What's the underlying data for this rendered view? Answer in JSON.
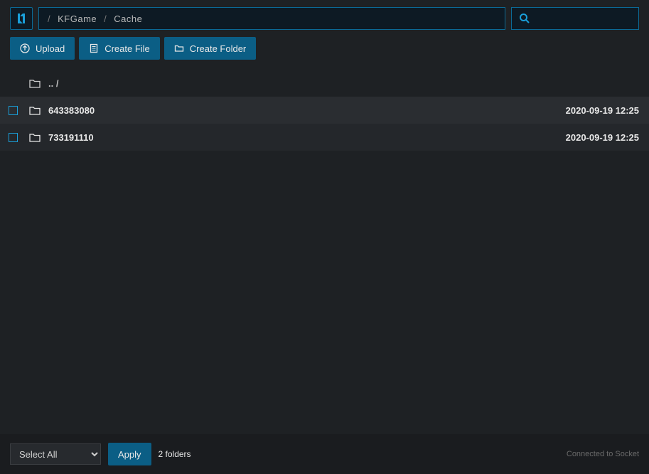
{
  "breadcrumb": {
    "items": [
      {
        "label": "KFGame"
      },
      {
        "label": "Cache"
      }
    ],
    "separator": "/"
  },
  "search": {
    "placeholder": ""
  },
  "toolbar": {
    "upload_label": "Upload",
    "create_file_label": "Create File",
    "create_folder_label": "Create Folder"
  },
  "file_list": {
    "parent_label": ".. /",
    "rows": [
      {
        "name": "643383080",
        "date": "2020-09-19 12:25"
      },
      {
        "name": "733191110",
        "date": "2020-09-19 12:25"
      }
    ]
  },
  "footer": {
    "select_all_label": "Select All",
    "apply_label": "Apply",
    "summary": "2 folders",
    "status": "Connected to Socket"
  }
}
